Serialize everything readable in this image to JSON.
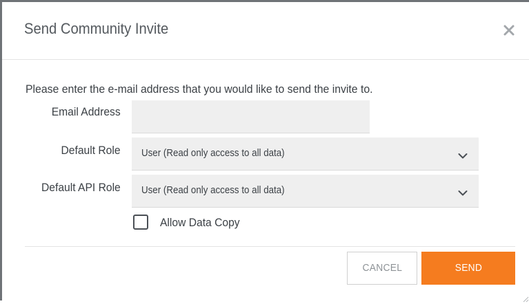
{
  "dialog": {
    "title": "Send Community Invite",
    "close_icon": "close-icon",
    "intro_text": "Please enter the e-mail address that you would like to send the invite to."
  },
  "form": {
    "email": {
      "label": "Email Address",
      "value": "",
      "placeholder": ""
    },
    "default_role": {
      "label": "Default Role",
      "selected": "User (Read only access to all data)",
      "icon": "chevron-down-icon"
    },
    "default_api_role": {
      "label": "Default API Role",
      "selected": "User (Read only access to all data)",
      "icon": "chevron-down-icon"
    },
    "allow_data_copy": {
      "label": "Allow Data Copy",
      "checked": false
    }
  },
  "footer": {
    "cancel_label": "CANCEL",
    "send_label": "SEND"
  },
  "colors": {
    "accent": "#f57c1f",
    "text": "#3c4146",
    "field_background": "#efefef",
    "border": "#6f7377"
  }
}
